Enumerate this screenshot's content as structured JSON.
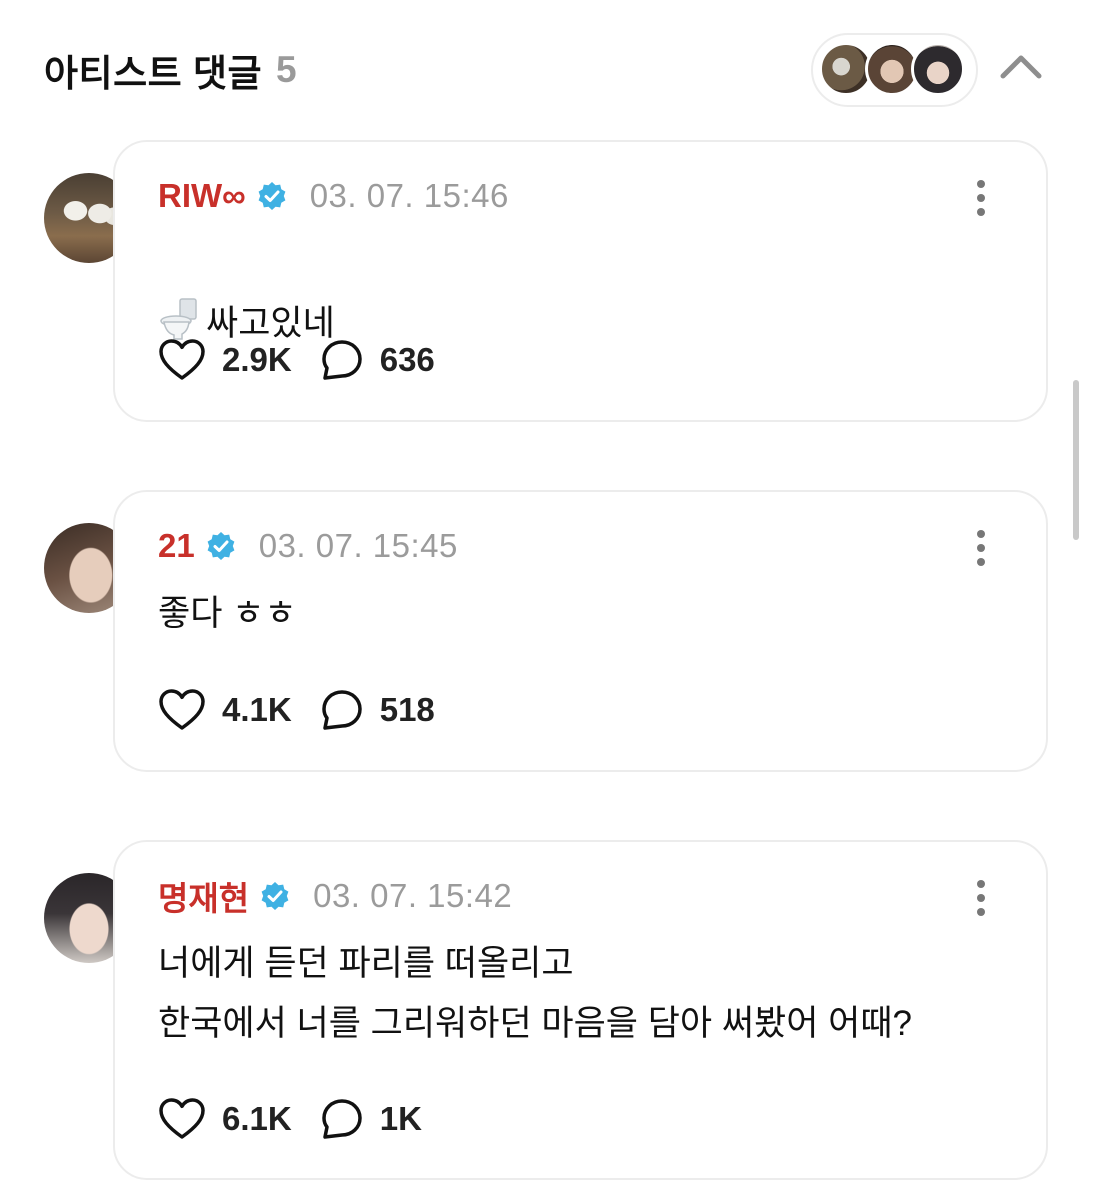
{
  "header": {
    "title": "아티스트 댓글",
    "count": "5"
  },
  "comments": [
    {
      "author": "RIW∞",
      "time": "03. 07. 15:46",
      "emoji": "toilet-emoji",
      "text": "싸고있네",
      "likes": "2.9K",
      "replies": "636"
    },
    {
      "author": "21",
      "time": "03. 07. 15:45",
      "text": "좋다 ㅎㅎ",
      "likes": "4.1K",
      "replies": "518"
    },
    {
      "author": "명재현",
      "time": "03. 07. 15:42",
      "text": "너에게 듣던 파리를 떠올리고\n한국에서 너를 그리워하던 마음을 담아 써봤어 어때?",
      "likes": "6.1K",
      "replies": "1K"
    }
  ],
  "colors": {
    "author": "#c8302a",
    "verified": "#3fb1e3",
    "muted": "#9b9b9b",
    "border": "#ececec"
  }
}
